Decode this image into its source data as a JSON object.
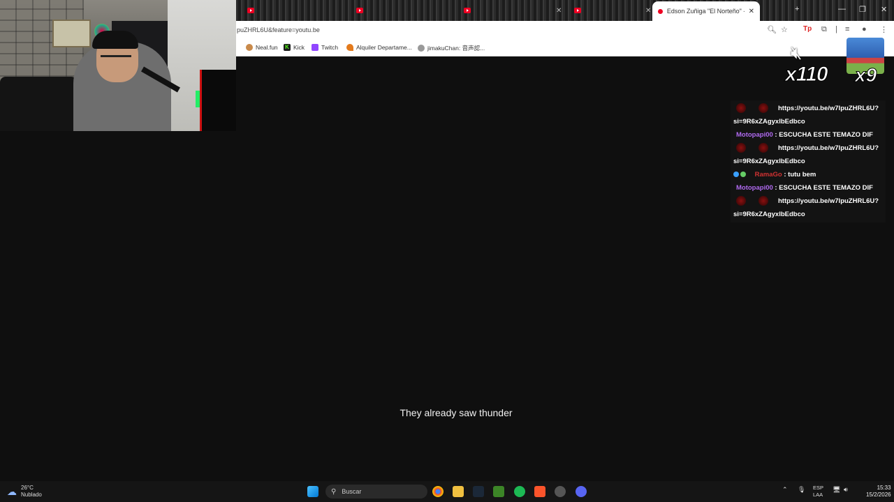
{
  "tabs": {
    "active_title": "Edson Zuñiga \"El Norteño\" - Sa"
  },
  "address_bar": {
    "url": "puZHRL6U&feature=youtu.be"
  },
  "bookmarks": [
    {
      "label": "Neal.fun"
    },
    {
      "label": "Kick"
    },
    {
      "label": "Twitch"
    },
    {
      "label": "Alquiler Departame..."
    },
    {
      "label": "jimakuChan: 音声認..."
    }
  ],
  "overlays": {
    "mute_count": "x110",
    "char_count": "x9"
  },
  "chat": {
    "messages": [
      {
        "user": "",
        "text": "https://youtu.be/w7IpuZHRL6U?si=9R6xZAgyxlbEdbco"
      },
      {
        "user": "Motopapi00",
        "text": ": ESCUCHA ESTE TEMAZO DIF"
      },
      {
        "user": "",
        "text": "https://youtu.be/w7IpuZHRL6U?si=9R6xZAgyxlbEdbco"
      },
      {
        "user": "RamaGo",
        "text": ": tutu bem"
      },
      {
        "user": "Motopapi00",
        "text": ": ESCUCHA ESTE TEMAZO DIF"
      },
      {
        "user": "",
        "text": "https://youtu.be/w7IpuZHRL6U?si=9R6xZAgyxlbEdbco"
      }
    ]
  },
  "video": {
    "subtitle": "They already saw thunder"
  },
  "taskbar": {
    "weather_temp": "26°C",
    "weather_desc": "Nublado",
    "search_label": "Buscar",
    "lang_1": "ESP",
    "lang_2": "LAA",
    "time": "15:33",
    "date": "15/2/2026"
  },
  "colors": {
    "chat_user": "#b06af0",
    "chat_user_alt": "#d23232",
    "accent_red": "#e00022"
  }
}
